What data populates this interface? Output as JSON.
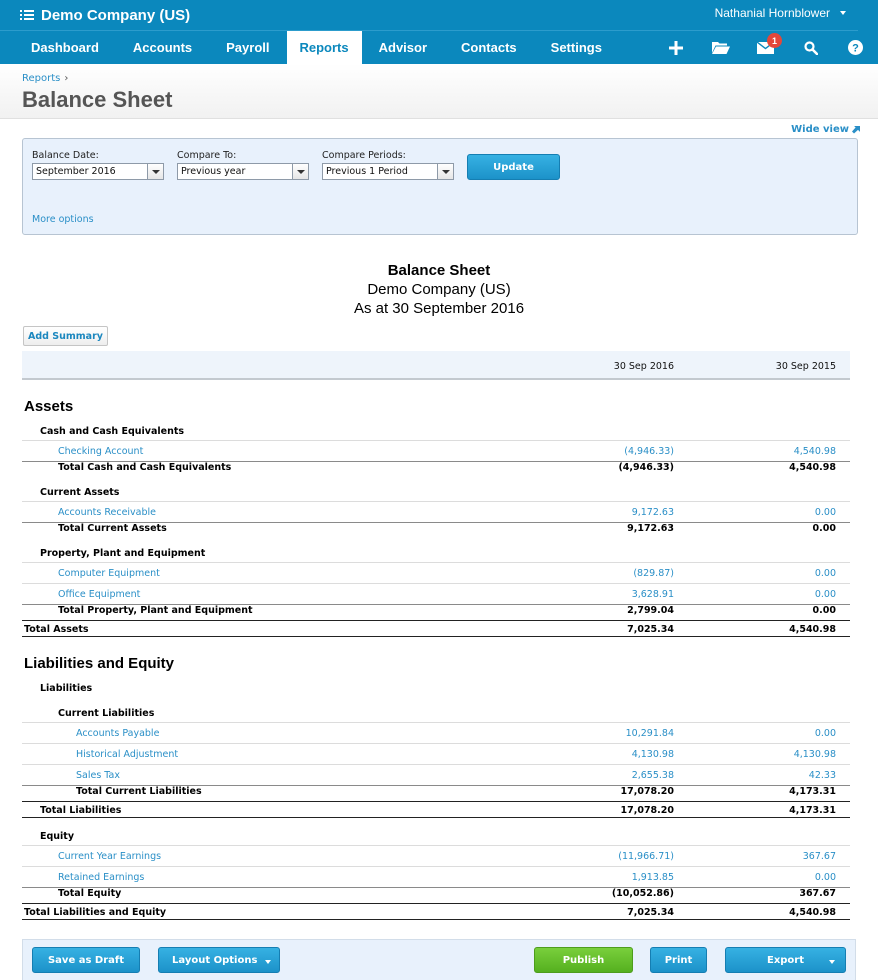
{
  "topbar": {
    "org_name": "Demo Company (US)",
    "user_name": "Nathanial Hornblower",
    "nav": [
      {
        "label": "Dashboard",
        "active": false
      },
      {
        "label": "Accounts",
        "active": false
      },
      {
        "label": "Payroll",
        "active": false
      },
      {
        "label": "Reports",
        "active": true
      },
      {
        "label": "Advisor",
        "active": false
      },
      {
        "label": "Contacts",
        "active": false
      },
      {
        "label": "Settings",
        "active": false
      }
    ],
    "icons": [
      "plus-icon",
      "folder-icon",
      "mail-icon",
      "search-icon",
      "help-icon"
    ],
    "mail_badge": "1"
  },
  "header": {
    "breadcrumb": "Reports",
    "breadcrumb_sep": "›",
    "title": "Balance Sheet"
  },
  "wide_view": "Wide view",
  "options": {
    "balance_date": {
      "label": "Balance Date:",
      "value": "September 2016"
    },
    "compare_to": {
      "label": "Compare To:",
      "value": "Previous year"
    },
    "compare_periods": {
      "label": "Compare Periods:",
      "value": "Previous 1 Period"
    },
    "update_label": "Update",
    "more_options": "More options"
  },
  "report": {
    "title": "Balance Sheet",
    "company": "Demo Company (US)",
    "as_at": "As at 30 September 2016",
    "add_summary": "Add Summary",
    "columns": [
      "30 Sep 2016",
      "30 Sep 2015"
    ],
    "rows": [
      {
        "type": "section",
        "label": "Assets"
      },
      {
        "type": "group",
        "label": "Cash and Cash Equivalents",
        "level": 1
      },
      {
        "type": "account",
        "label": "Checking Account",
        "level": 2,
        "v1": "(4,946.33)",
        "v2": "4,540.98"
      },
      {
        "type": "total",
        "label": "Total Cash and Cash Equivalents",
        "level": 2,
        "v1": "(4,946.33)",
        "v2": "4,540.98"
      },
      {
        "type": "group",
        "label": "Current Assets",
        "level": 1
      },
      {
        "type": "account",
        "label": "Accounts Receivable",
        "level": 2,
        "v1": "9,172.63",
        "v2": "0.00"
      },
      {
        "type": "total",
        "label": "Total Current Assets",
        "level": 2,
        "v1": "9,172.63",
        "v2": "0.00"
      },
      {
        "type": "group",
        "label": "Property, Plant and Equipment",
        "level": 1
      },
      {
        "type": "account",
        "label": "Computer Equipment",
        "level": 2,
        "v1": "(829.87)",
        "v2": "0.00"
      },
      {
        "type": "account",
        "label": "Office Equipment",
        "level": 2,
        "v1": "3,628.91",
        "v2": "0.00"
      },
      {
        "type": "total",
        "label": "Total Property, Plant and Equipment",
        "level": 2,
        "v1": "2,799.04",
        "v2": "0.00"
      },
      {
        "type": "grandtotal",
        "label": "Total Assets",
        "level": 0,
        "v1": "7,025.34",
        "v2": "4,540.98"
      },
      {
        "type": "section",
        "label": "Liabilities and Equity"
      },
      {
        "type": "group",
        "label": "Liabilities",
        "level": 1
      },
      {
        "type": "group",
        "label": "Current Liabilities",
        "level": 2
      },
      {
        "type": "account",
        "label": "Accounts Payable",
        "level": 3,
        "v1": "10,291.84",
        "v2": "0.00"
      },
      {
        "type": "account",
        "label": "Historical Adjustment",
        "level": 3,
        "v1": "4,130.98",
        "v2": "4,130.98"
      },
      {
        "type": "account",
        "label": "Sales Tax",
        "level": 3,
        "v1": "2,655.38",
        "v2": "42.33"
      },
      {
        "type": "total",
        "label": "Total Current Liabilities",
        "level": 3,
        "v1": "17,078.20",
        "v2": "4,173.31"
      },
      {
        "type": "grandtotal",
        "label": "Total Liabilities",
        "level": 1,
        "v1": "17,078.20",
        "v2": "4,173.31"
      },
      {
        "type": "group",
        "label": "Equity",
        "level": 1
      },
      {
        "type": "account",
        "label": "Current Year Earnings",
        "level": 2,
        "v1": "(11,966.71)",
        "v2": "367.67"
      },
      {
        "type": "account",
        "label": "Retained Earnings",
        "level": 2,
        "v1": "1,913.85",
        "v2": "0.00"
      },
      {
        "type": "total",
        "label": "Total Equity",
        "level": 2,
        "v1": "(10,052.86)",
        "v2": "367.67"
      },
      {
        "type": "grandtotal",
        "label": "Total Liabilities and Equity",
        "level": 0,
        "v1": "7,025.34",
        "v2": "4,540.98"
      }
    ]
  },
  "footer": {
    "save_draft": "Save as Draft",
    "layout_options": "Layout Options",
    "publish": "Publish",
    "print": "Print",
    "export": "Export"
  }
}
